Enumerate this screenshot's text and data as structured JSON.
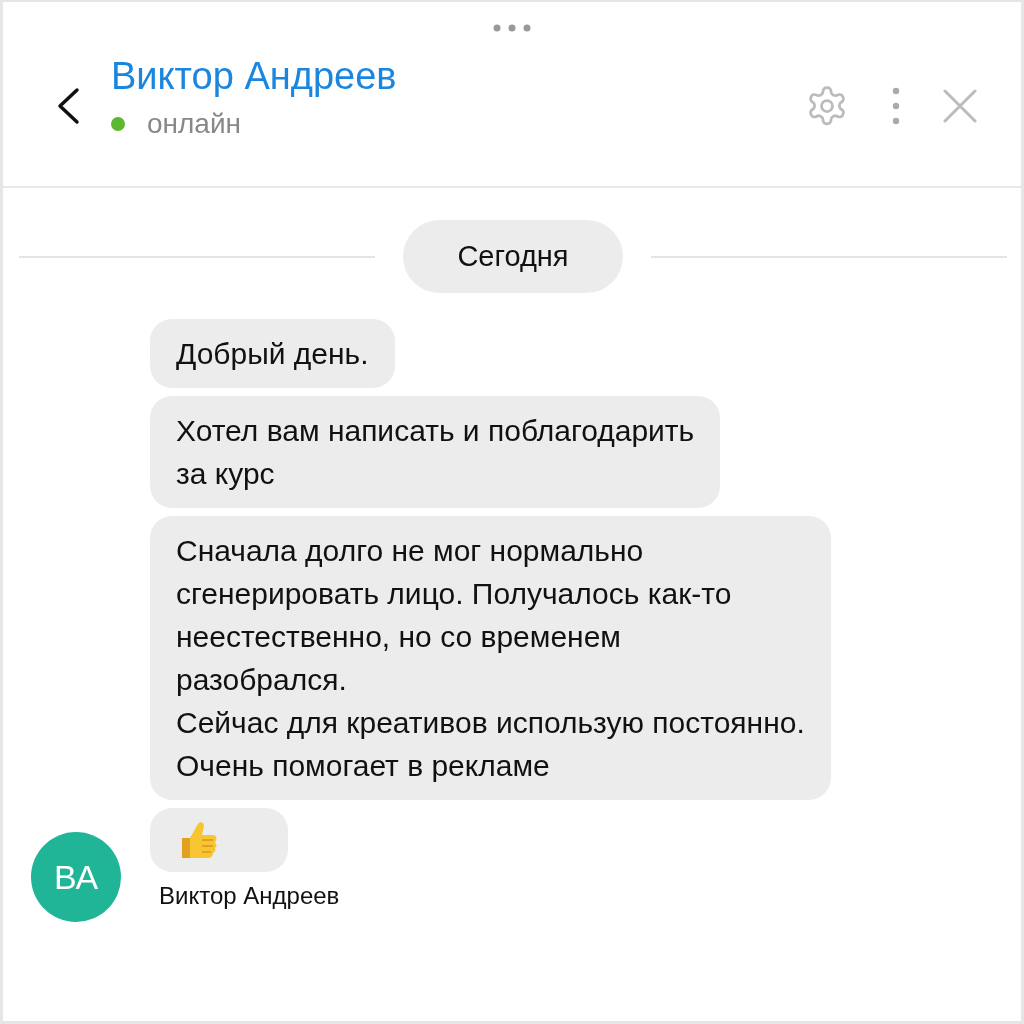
{
  "header": {
    "title": "Виктор Андреев",
    "status": "онлайн",
    "online": true
  },
  "date_divider": "Сегодня",
  "messages": [
    {
      "kind": "text",
      "text": "Добрый день."
    },
    {
      "kind": "text",
      "text": "Хотел вам написать и поблагодарить\nза курс"
    },
    {
      "kind": "text",
      "text": "Сначала долго не мог нормально\nсгенерировать лицо. Получалось как-то\nнеестественно, но со временем\nразобрался.\nСейчас для креативов использую постоянно.\nОчень помогает в рекламе"
    },
    {
      "kind": "thumbs_up"
    }
  ],
  "sender": {
    "initials": "ВА",
    "name": "Виктор Андреев",
    "color": "#20b597"
  }
}
